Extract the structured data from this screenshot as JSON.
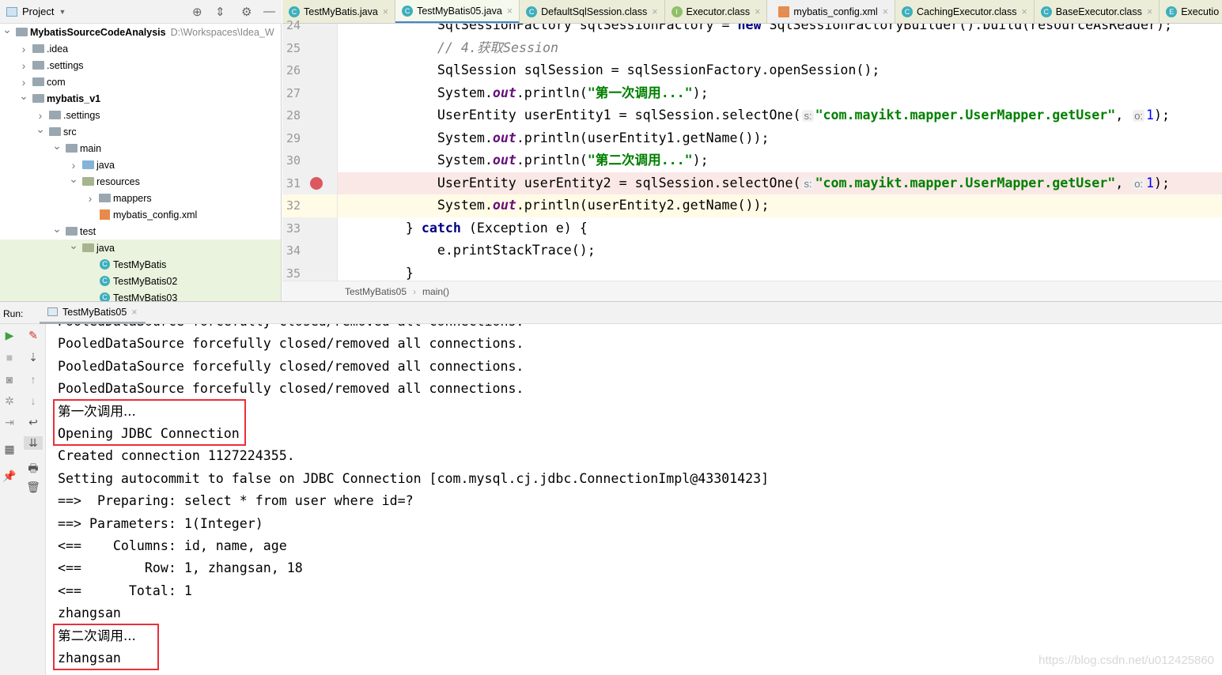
{
  "project_panel": {
    "title": "Project",
    "tree": [
      {
        "label": "MybatisSourceCodeAnalysis",
        "path": "D:\\Workspaces\\Idea_W",
        "level": 0,
        "arrow": "down",
        "icon": "module",
        "bold": true
      },
      {
        "label": ".idea",
        "level": 1,
        "arrow": "right",
        "icon": "folder"
      },
      {
        "label": ".settings",
        "level": 1,
        "arrow": "right",
        "icon": "folder"
      },
      {
        "label": "com",
        "level": 1,
        "arrow": "right",
        "icon": "folder"
      },
      {
        "label": "mybatis_v1",
        "level": 1,
        "arrow": "down",
        "icon": "module",
        "bold": true
      },
      {
        "label": ".settings",
        "level": 2,
        "arrow": "right",
        "icon": "folder"
      },
      {
        "label": "src",
        "level": 2,
        "arrow": "down",
        "icon": "folder"
      },
      {
        "label": "main",
        "level": 3,
        "arrow": "down",
        "icon": "folder"
      },
      {
        "label": "java",
        "level": 4,
        "arrow": "right",
        "icon": "source-folder"
      },
      {
        "label": "resources",
        "level": 4,
        "arrow": "down",
        "icon": "resource-folder"
      },
      {
        "label": "mappers",
        "level": 5,
        "arrow": "right",
        "icon": "folder"
      },
      {
        "label": "mybatis_config.xml",
        "level": 5,
        "arrow": "",
        "icon": "xml"
      },
      {
        "label": "test",
        "level": 3,
        "arrow": "down",
        "icon": "folder"
      },
      {
        "label": "java",
        "level": 4,
        "arrow": "down",
        "icon": "test-folder",
        "selected": true
      },
      {
        "label": "TestMyBatis",
        "level": 5,
        "arrow": "",
        "icon": "class",
        "selected": true
      },
      {
        "label": "TestMyBatis02",
        "level": 5,
        "arrow": "",
        "icon": "class",
        "selected": true
      },
      {
        "label": "TestMyBatis03",
        "level": 5,
        "arrow": "",
        "icon": "class",
        "selected": true
      }
    ]
  },
  "editor_tabs": [
    {
      "label": "TestMyBatis.java",
      "icon": "C"
    },
    {
      "label": "TestMyBatis05.java",
      "icon": "C",
      "active": true
    },
    {
      "label": "DefaultSqlSession.class",
      "icon": "C"
    },
    {
      "label": "Executor.class",
      "icon": "I"
    },
    {
      "label": "mybatis_config.xml",
      "icon": "X",
      "grey": true
    },
    {
      "label": "CachingExecutor.class",
      "icon": "C"
    },
    {
      "label": "BaseExecutor.class",
      "icon": "C"
    },
    {
      "label": "Executio",
      "icon": "E"
    }
  ],
  "code": {
    "breakpoint_line": 31,
    "current_line": 32,
    "lines": [
      {
        "n": "24",
        "tokens": [
          [
            "            SqlSessionFactory sqlSessionFactory = ",
            ""
          ],
          [
            "new",
            "kw"
          ],
          [
            " SqlSessionFactoryBuilder().build(resourceAsReader);",
            ""
          ]
        ]
      },
      {
        "n": "25",
        "tokens": [
          [
            "            ",
            ""
          ],
          [
            "// 4.获取Session",
            "cmt"
          ]
        ]
      },
      {
        "n": "26",
        "tokens": [
          [
            "            SqlSession sqlSession = sqlSessionFactory.openSession();",
            ""
          ]
        ]
      },
      {
        "n": "27",
        "tokens": [
          [
            "            System.",
            ""
          ],
          [
            "out",
            "fld"
          ],
          [
            ".println(",
            ""
          ],
          [
            "\"第一次调用...\"",
            "str"
          ],
          [
            ");",
            ""
          ]
        ]
      },
      {
        "n": "28",
        "tokens": [
          [
            "            UserEntity userEntity1 = sqlSession.selectOne(",
            ""
          ],
          [
            "s:",
            "hint"
          ],
          [
            "\"com.mayikt.mapper.UserMapper.getUser\"",
            "str"
          ],
          [
            ", ",
            ""
          ],
          [
            "o:",
            "hint"
          ],
          [
            "1",
            "num"
          ],
          [
            ");",
            ""
          ]
        ]
      },
      {
        "n": "29",
        "tokens": [
          [
            "            System.",
            ""
          ],
          [
            "out",
            "fld"
          ],
          [
            ".println(userEntity1.getName());",
            ""
          ]
        ]
      },
      {
        "n": "30",
        "tokens": [
          [
            "            System.",
            ""
          ],
          [
            "out",
            "fld"
          ],
          [
            ".println(",
            ""
          ],
          [
            "\"第二次调用...\"",
            "str"
          ],
          [
            ");",
            ""
          ]
        ]
      },
      {
        "n": "31",
        "tokens": [
          [
            "            UserEntity userEntity2 = sqlSession.selectOne(",
            ""
          ],
          [
            "s:",
            "hint"
          ],
          [
            "\"com.mayikt.mapper.UserMapper.getUser\"",
            "str"
          ],
          [
            ", ",
            ""
          ],
          [
            "o:",
            "hint"
          ],
          [
            "1",
            "num"
          ],
          [
            ");",
            ""
          ]
        ]
      },
      {
        "n": "32",
        "tokens": [
          [
            "            System.",
            ""
          ],
          [
            "out",
            "fld"
          ],
          [
            ".println(userEntity2.getName());",
            ""
          ]
        ]
      },
      {
        "n": "33",
        "tokens": [
          [
            "        } ",
            ""
          ],
          [
            "catch",
            "kw"
          ],
          [
            " (Exception e) {",
            ""
          ]
        ]
      },
      {
        "n": "34",
        "tokens": [
          [
            "            e.printStackTrace();",
            ""
          ]
        ]
      },
      {
        "n": "35",
        "tokens": [
          [
            "        }",
            ""
          ]
        ]
      }
    ]
  },
  "breadcrumb": [
    "TestMyBatis05",
    "main()"
  ],
  "run": {
    "label": "Run:",
    "tab": "TestMyBatis05",
    "output": [
      "PooledDataSource forcefully closed/removed all connections.",
      "PooledDataSource forcefully closed/removed all connections.",
      "PooledDataSource forcefully closed/removed all connections.",
      "PooledDataSource forcefully closed/removed all connections.",
      "第一次调用...",
      "Opening JDBC Connection",
      "Created connection 1127224355.",
      "Setting autocommit to false on JDBC Connection [com.mysql.cj.jdbc.ConnectionImpl@43301423]",
      "==>  Preparing: select * from user where id=?",
      "==> Parameters: 1(Integer)",
      "<==    Columns: id, name, age",
      "<==        Row: 1, zhangsan, 18",
      "<==      Total: 1",
      "zhangsan",
      "第二次调用...",
      "zhangsan"
    ],
    "highlight_color": "#e8303a"
  },
  "watermark": "https://blog.csdn.net/u012425860"
}
